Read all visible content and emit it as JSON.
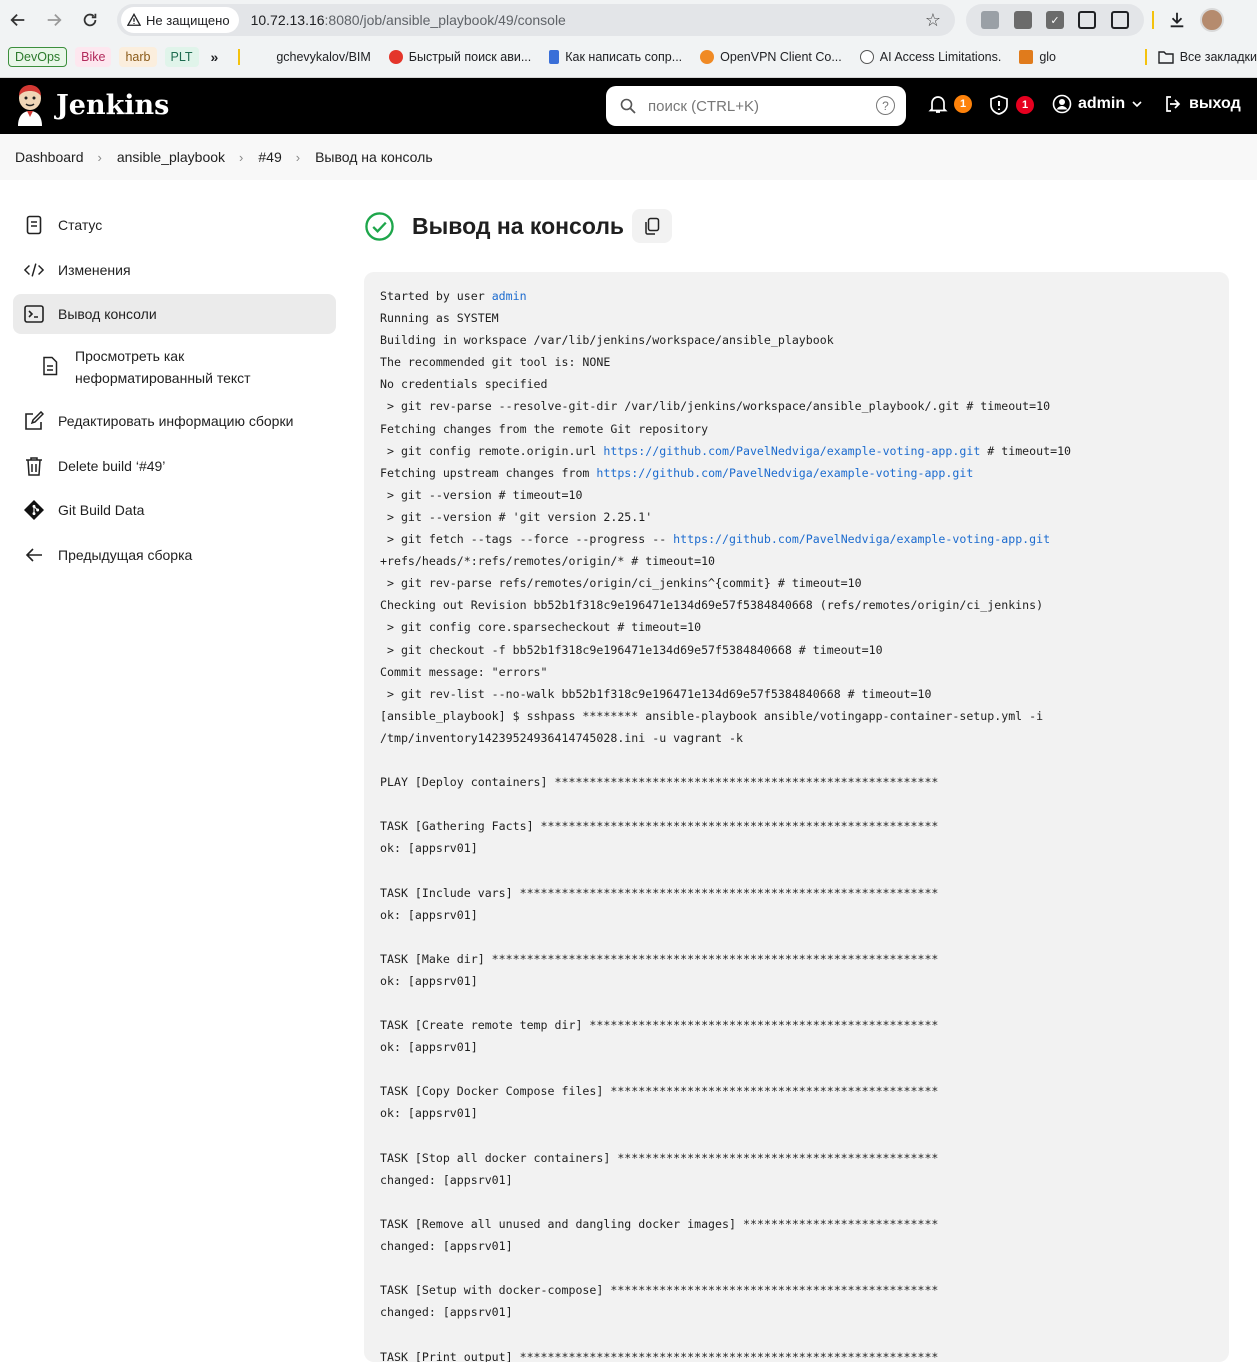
{
  "browser": {
    "security_label": "Не защищено",
    "url_host": "10.72.13.16",
    "url_rest": ":8080/job/ansible_playbook/49/console",
    "bookmarks": {
      "tags": [
        "DevOps",
        "Bike",
        "harb",
        "PLT"
      ],
      "items": [
        "gchevykalov/BIM",
        "Быстрый поиск ави...",
        "Как написать сопр...",
        "OpenVPN Client Co...",
        "AI Access Limitations.",
        "glo"
      ],
      "all_label": "Все закладки"
    }
  },
  "jenkins": {
    "logo_text": "Jenkins",
    "search_placeholder": "поиск (CTRL+K)",
    "notifications_count": "1",
    "security_count": "1",
    "user": "admin",
    "logout": "выход"
  },
  "breadcrumb": [
    "Dashboard",
    "ansible_playbook",
    "#49",
    "Вывод на консоль"
  ],
  "sidebar": {
    "items": [
      {
        "label": "Статус",
        "icon": "document-icon"
      },
      {
        "label": "Изменения",
        "icon": "code-icon"
      },
      {
        "label": "Вывод консоли",
        "icon": "terminal-icon"
      },
      {
        "label": "Просмотреть как неформатированный текст",
        "icon": "file-text-icon"
      },
      {
        "label": "Редактировать информацию сборки",
        "icon": "edit-icon"
      },
      {
        "label": "Delete build ‘#49’",
        "icon": "trash-icon"
      },
      {
        "label": "Git Build Data",
        "icon": "git-icon"
      },
      {
        "label": "Предыдущая сборка",
        "icon": "arrow-left-icon"
      }
    ]
  },
  "main": {
    "title": "Вывод на консоль",
    "status_color": "#1ea64b",
    "console_lines": [
      [
        "Started by user ",
        {
          "link": "admin"
        }
      ],
      [
        "Running as SYSTEM"
      ],
      [
        "Building in workspace /var/lib/jenkins/workspace/ansible_playbook"
      ],
      [
        "The recommended git tool is: NONE"
      ],
      [
        "No credentials specified"
      ],
      [
        " > git rev-parse --resolve-git-dir /var/lib/jenkins/workspace/ansible_playbook/.git # timeout=10"
      ],
      [
        "Fetching changes from the remote Git repository"
      ],
      [
        " > git config remote.origin.url ",
        {
          "link": "https://github.com/PavelNedviga/example-voting-app.git"
        },
        " # timeout=10"
      ],
      [
        "Fetching upstream changes from ",
        {
          "link": "https://github.com/PavelNedviga/example-voting-app.git"
        }
      ],
      [
        " > git --version # timeout=10"
      ],
      [
        " > git --version # 'git version 2.25.1'"
      ],
      [
        " > git fetch --tags --force --progress -- ",
        {
          "link": "https://github.com/PavelNedviga/example-voting-app.git"
        }
      ],
      [
        "+refs/heads/*:refs/remotes/origin/* # timeout=10"
      ],
      [
        " > git rev-parse refs/remotes/origin/ci_jenkins^{commit} # timeout=10"
      ],
      [
        "Checking out Revision bb52b1f318c9e196471e134d69e57f5384840668 (refs/remotes/origin/ci_jenkins)"
      ],
      [
        " > git config core.sparsecheckout # timeout=10"
      ],
      [
        " > git checkout -f bb52b1f318c9e196471e134d69e57f5384840668 # timeout=10"
      ],
      [
        "Commit message: \"errors\""
      ],
      [
        " > git rev-list --no-walk bb52b1f318c9e196471e134d69e57f5384840668 # timeout=10"
      ],
      [
        "[ansible_playbook] $ sshpass ******** ansible-playbook ansible/votingapp-container-setup.yml -i"
      ],
      [
        "/tmp/inventory14239524936414745028.ini -u vagrant -k"
      ],
      [
        ""
      ],
      [
        "PLAY [Deploy containers] *******************************************************"
      ],
      [
        ""
      ],
      [
        "TASK [Gathering Facts] *********************************************************"
      ],
      [
        "ok: [appsrv01]"
      ],
      [
        ""
      ],
      [
        "TASK [Include vars] ************************************************************"
      ],
      [
        "ok: [appsrv01]"
      ],
      [
        ""
      ],
      [
        "TASK [Make dir] ****************************************************************"
      ],
      [
        "ok: [appsrv01]"
      ],
      [
        ""
      ],
      [
        "TASK [Create remote temp dir] **************************************************"
      ],
      [
        "ok: [appsrv01]"
      ],
      [
        ""
      ],
      [
        "TASK [Copy Docker Compose files] ***********************************************"
      ],
      [
        "ok: [appsrv01]"
      ],
      [
        ""
      ],
      [
        "TASK [Stop all docker containers] **********************************************"
      ],
      [
        "changed: [appsrv01]"
      ],
      [
        ""
      ],
      [
        "TASK [Remove all unused and dangling docker images] ****************************"
      ],
      [
        "changed: [appsrv01]"
      ],
      [
        ""
      ],
      [
        "TASK [Setup with docker-compose] ***********************************************"
      ],
      [
        "changed: [appsrv01]"
      ],
      [
        ""
      ],
      [
        "TASK [Print output] ************************************************************"
      ]
    ]
  }
}
